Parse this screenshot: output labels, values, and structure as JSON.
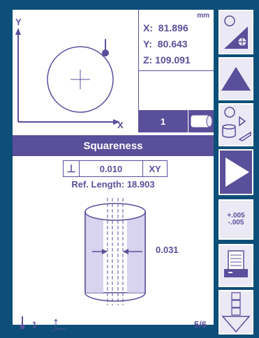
{
  "plot": {
    "axis_y": "Y",
    "axis_x": "X"
  },
  "coords": {
    "units": "mm",
    "x": "X:  81.896",
    "y": "Y:  80.643",
    "z": "Z: 109.091"
  },
  "status": {
    "number": "1"
  },
  "feature": {
    "title": "Squareness",
    "tolerance_symbol": "⊥",
    "value": "0.010",
    "datum": "XY",
    "ref_length": "Ref. Length: 18.903",
    "deviation": "0.031"
  },
  "footer": {
    "index": "1",
    "page": "5/6"
  },
  "toolbar": {
    "tol_plus": "+.005",
    "tol_minus": "-.005"
  },
  "colors": {
    "background": "#0d4f78",
    "accent": "#5a4f9a",
    "light": "#ece9f6"
  }
}
